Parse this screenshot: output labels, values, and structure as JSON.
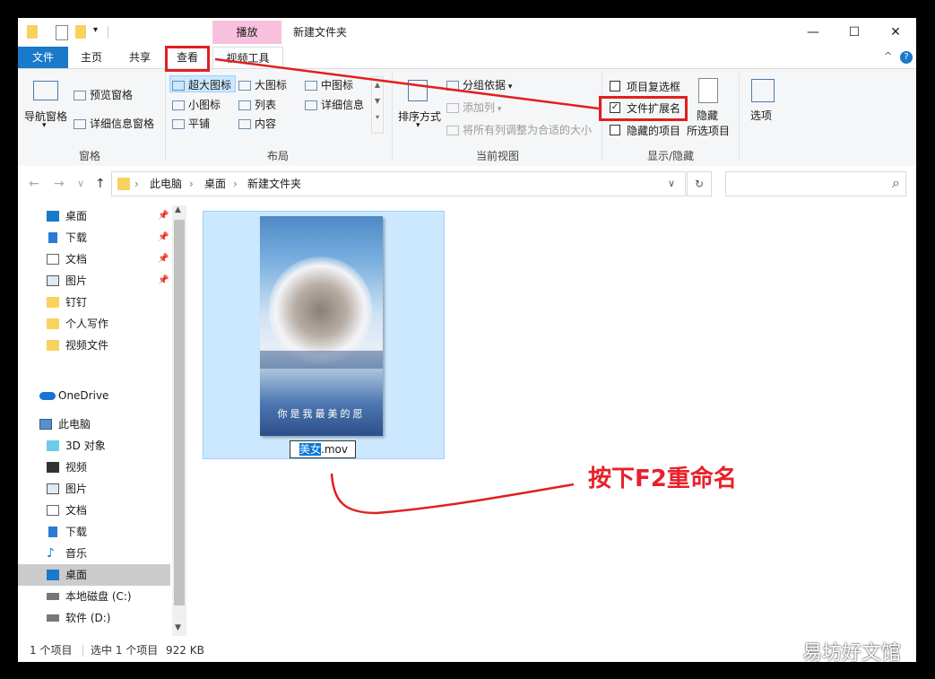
{
  "window": {
    "title": "新建文件夹",
    "context_tab_header": "播放",
    "controls": {
      "minimize": "—",
      "maximize": "☐",
      "close": "✕"
    }
  },
  "ribbon_tabs": {
    "file": "文件",
    "home": "主页",
    "share": "共享",
    "view": "查看",
    "video_tools": "视频工具",
    "help": "?"
  },
  "ribbon": {
    "panes": {
      "label": "窗格",
      "nav_pane": "导航窗格",
      "preview_pane": "预览窗格",
      "details_pane": "详细信息窗格"
    },
    "layout": {
      "label": "布局",
      "items": [
        "超大图标",
        "大图标",
        "中图标",
        "小图标",
        "列表",
        "详细信息",
        "平铺",
        "内容"
      ]
    },
    "current_view": {
      "label": "当前视图",
      "sort_by": "排序方式",
      "group_by": "分组依据",
      "add_column": "添加列",
      "size_columns": "将所有列调整为合适的大小"
    },
    "show_hide": {
      "label": "显示/隐藏",
      "item_checkboxes": "项目复选框",
      "item_checkboxes_checked": false,
      "file_extensions": "文件扩展名",
      "file_extensions_checked": true,
      "hidden_items": "隐藏的项目",
      "hidden_items_checked": false,
      "hide_selected_l1": "隐藏",
      "hide_selected_l2": "所选项目"
    },
    "options": "选项"
  },
  "address": {
    "back": "←",
    "forward": "→",
    "recent": "∨",
    "up": "↑",
    "crumbs": [
      "此电脑",
      "桌面",
      "新建文件夹"
    ],
    "separator": "›",
    "dropdown": "∨",
    "refresh": "↻",
    "search_placeholder": "",
    "search_icon": "⌕"
  },
  "sidebar": {
    "quick_access": [
      {
        "label": "桌面",
        "pinned": true
      },
      {
        "label": "下载",
        "pinned": true
      },
      {
        "label": "文档",
        "pinned": true
      },
      {
        "label": "图片",
        "pinned": true
      },
      {
        "label": "钉钉",
        "pinned": false
      },
      {
        "label": "个人写作",
        "pinned": false
      },
      {
        "label": "视频文件",
        "pinned": false
      }
    ],
    "onedrive": "OneDrive",
    "this_pc": "此电脑",
    "pc_items": [
      "3D 对象",
      "视频",
      "图片",
      "文档",
      "下载",
      "音乐",
      "桌面",
      "本地磁盘 (C:)",
      "软件 (D:)"
    ],
    "selected": "桌面",
    "pin_glyph": "📌"
  },
  "file": {
    "thumbnail_caption": "你是我最美的愿",
    "rename_selected": "美女",
    "rename_rest": ".mov"
  },
  "status": {
    "item_count": "1 个项目",
    "selection": "选中 1 个项目",
    "size": "922 KB"
  },
  "annotation": {
    "text": "按下F2重命名",
    "color": "#e02020"
  },
  "watermark": "易坊好文馆"
}
